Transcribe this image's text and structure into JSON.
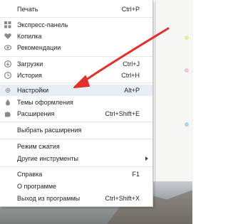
{
  "menu": {
    "items": [
      {
        "label": "Печать",
        "accel": "Ctrl+P",
        "icon": ""
      },
      {
        "label": "Экспресс-панель",
        "accel": "",
        "icon": "grid-icon"
      },
      {
        "label": "Копилка",
        "accel": "",
        "icon": "heart-icon"
      },
      {
        "label": "Рекомендации",
        "accel": "",
        "icon": "eye-icon"
      },
      {
        "label": "Загрузки",
        "accel": "Ctrl+J",
        "icon": "download-icon"
      },
      {
        "label": "История",
        "accel": "Ctrl+H",
        "icon": "clock-icon"
      },
      {
        "label": "Настройки",
        "accel": "Alt+P",
        "icon": "gear-icon"
      },
      {
        "label": "Темы оформления",
        "accel": "",
        "icon": "drop-icon"
      },
      {
        "label": "Расширения",
        "accel": "Ctrl+Shift+E",
        "icon": "puzzle-icon"
      },
      {
        "label": "Выбрать расширения",
        "accel": "",
        "icon": ""
      },
      {
        "label": "Режим сжатия",
        "accel": "",
        "icon": ""
      },
      {
        "label": "Другие инструменты",
        "accel": "",
        "icon": ""
      },
      {
        "label": "Справка",
        "accel": "F1",
        "icon": ""
      },
      {
        "label": "О программе",
        "accel": "",
        "icon": ""
      },
      {
        "label": "Выход из программы",
        "accel": "Ctrl+Shift+X",
        "icon": ""
      }
    ]
  },
  "colors": {
    "arrow": "#e0312d",
    "highlight": "#e8eef6"
  }
}
